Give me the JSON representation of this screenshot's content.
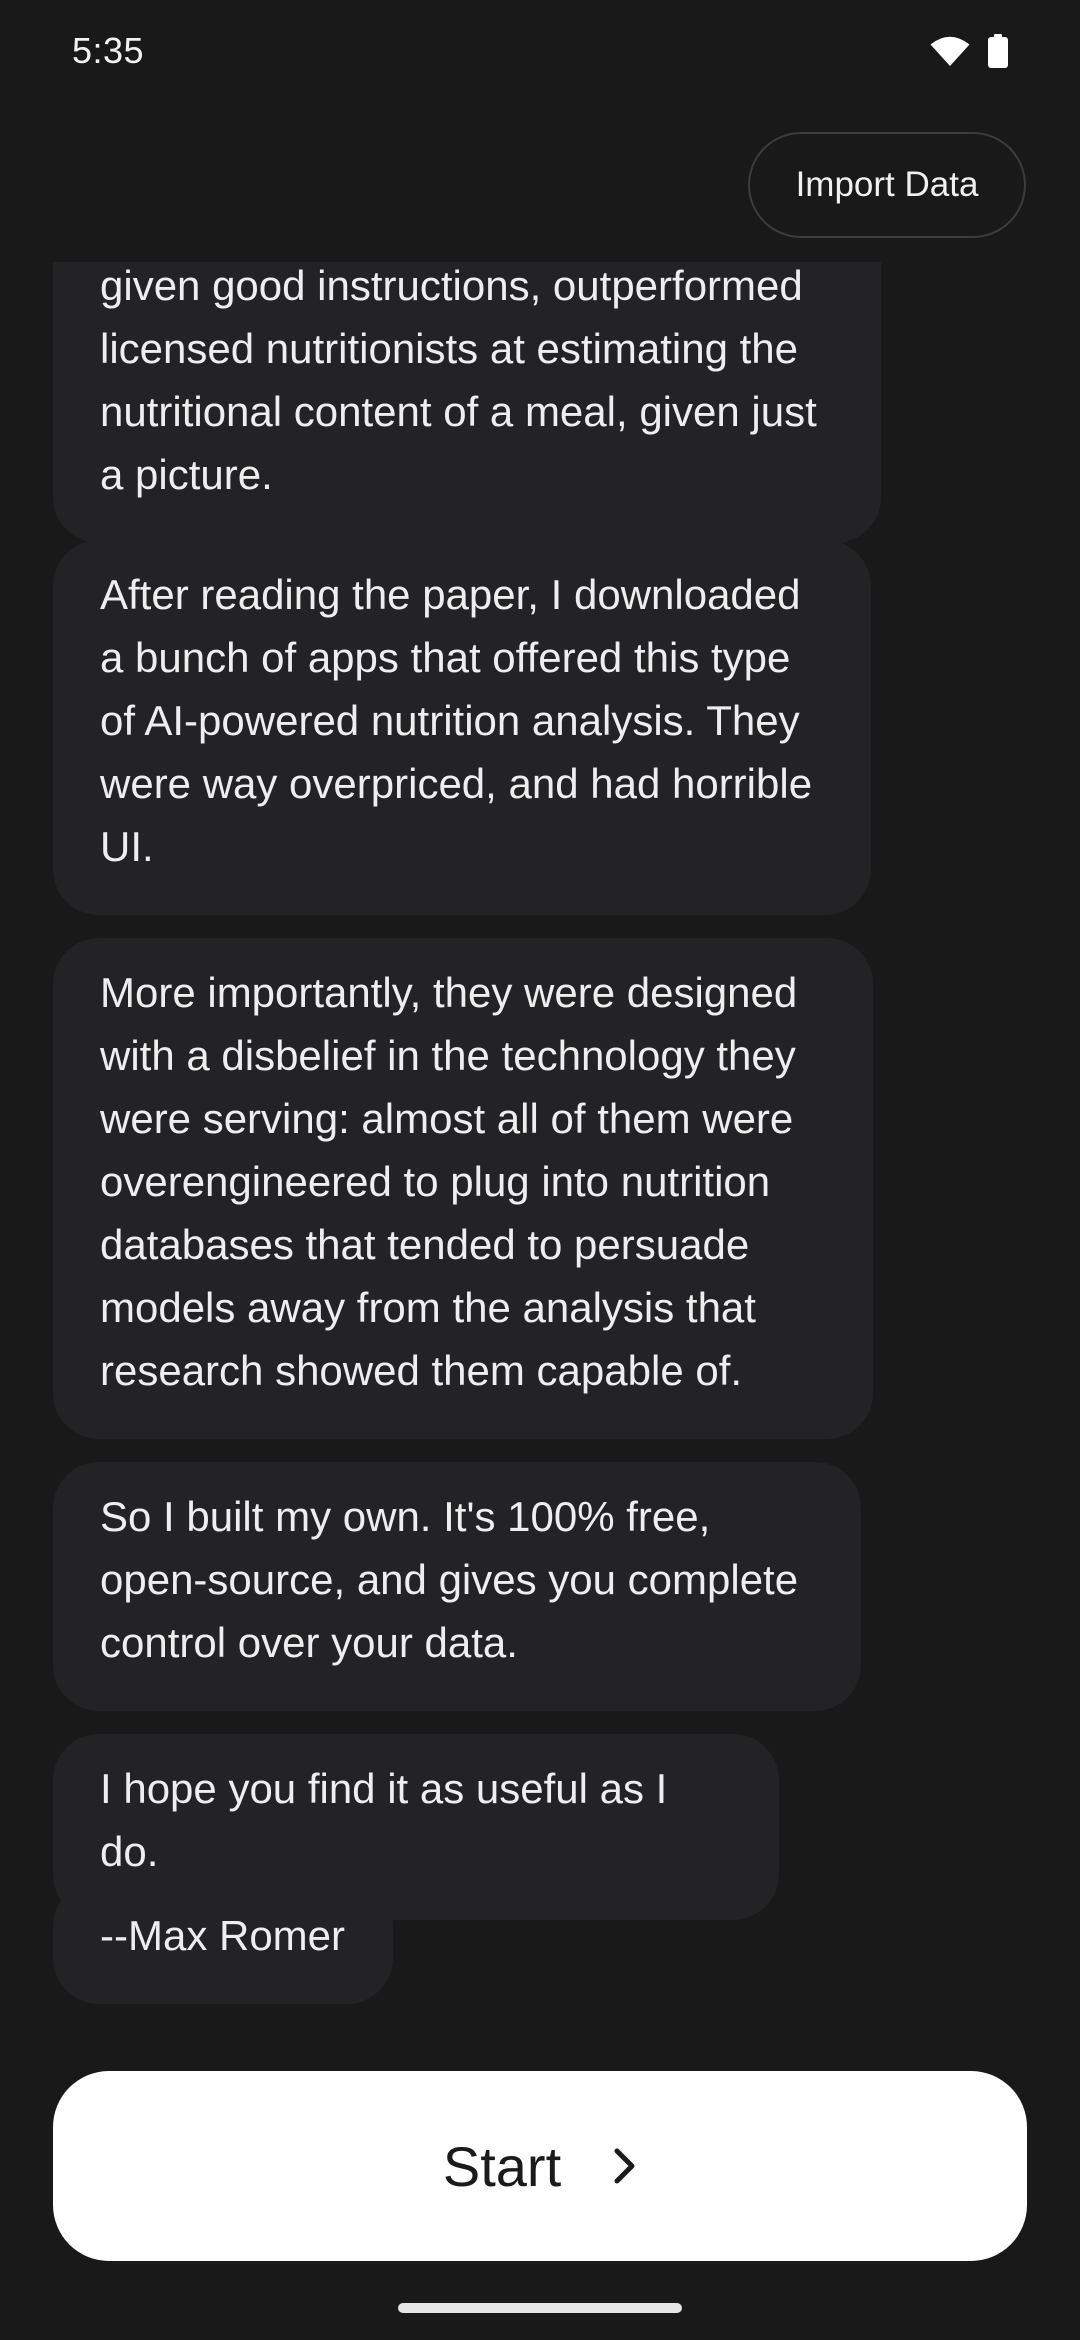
{
  "status_bar": {
    "time": "5:35"
  },
  "header": {
    "import_label": "Import Data"
  },
  "messages": [
    "given good instructions, outperformed licensed nutritionists at estimating the nutritional content of a meal, given just a picture.",
    "After reading the paper, I downloaded a bunch of apps that offered this type of AI-powered nutrition analysis. They were way overpriced, and had horrible UI.",
    "More importantly, they were designed with a disbelief in the technology they were serving: almost all of them were overengineered to plug into nutrition databases that tended to persuade models away from the analysis that research showed them capable of.",
    "So I built my own. It's 100% free, open-source, and gives you complete control over your data.",
    "I hope you find it as useful as I do.",
    "--Max Romer"
  ],
  "footer": {
    "start_label": "Start"
  },
  "icons": {
    "wifi": "wifi-icon",
    "battery": "battery-icon",
    "start_chevron": "chevron-right-icon"
  },
  "colors": {
    "background": "#19191a",
    "bubble": "#232325",
    "text": "#eeeeee",
    "start_button": "#ffffff"
  }
}
